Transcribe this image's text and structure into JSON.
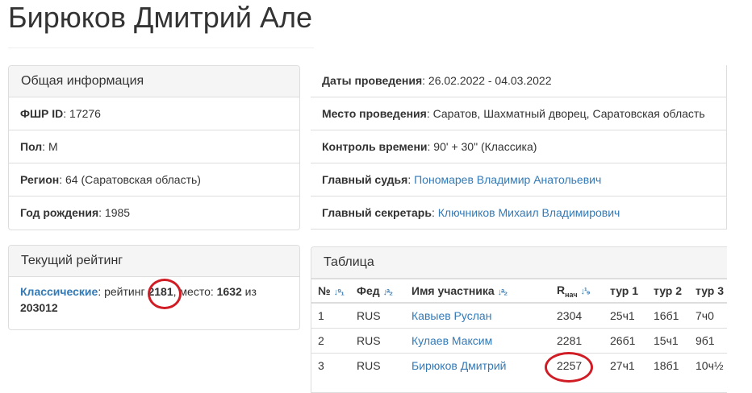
{
  "page_title": "Бирюков Дмитрий Але",
  "info": {
    "heading": "Общая информация",
    "rows": [
      {
        "label": "ФШР ID",
        "value": ": 17276"
      },
      {
        "label": "Пол",
        "value": ": М"
      },
      {
        "label": "Регион",
        "value": ": 64 (Саратовская область)"
      },
      {
        "label": "Год рождения",
        "value": ": 1985"
      }
    ]
  },
  "rating": {
    "heading": "Текущий рейтинг",
    "type_link": "Классические",
    "text1": ": рейтинг ",
    "value": "2181",
    "text2": ", место: ",
    "place": "1632",
    "text3": " из",
    "total": "203012",
    "highlight_color": "#d01c24"
  },
  "event": {
    "rows": [
      {
        "label": "Даты проведения",
        "value": ": 26.02.2022 - 04.03.2022",
        "link": ""
      },
      {
        "label": "Место проведения",
        "value": ": Саратов, Шахматный дворец, Саратовская область",
        "link": ""
      },
      {
        "label": "Контроль времени",
        "value": ": 90' + 30\" (Классика)",
        "link": ""
      },
      {
        "label": "Главный судья",
        "value": ": ",
        "link": "Пономарев Владимир Анатольевич"
      },
      {
        "label": "Главный секретарь",
        "value": ": ",
        "link": "Ключников Михаил Владимирович"
      }
    ]
  },
  "table": {
    "heading": "Таблица",
    "columns": [
      "№",
      "Фед",
      "Имя участника",
      "R",
      "тур 1",
      "тур 2",
      "тур 3"
    ],
    "r_sub": "нач",
    "rows": [
      [
        "1",
        "RUS",
        "Кавыев Руслан",
        "2304",
        "25ч1",
        "16б1",
        "7ч0"
      ],
      [
        "2",
        "RUS",
        "Кулаев Максим",
        "2281",
        "26б1",
        "15ч1",
        "9б1"
      ],
      [
        "3",
        "RUS",
        "Бирюков Дмитрий",
        "2257",
        "27ч1",
        "18б1",
        "10ч½"
      ]
    ]
  }
}
